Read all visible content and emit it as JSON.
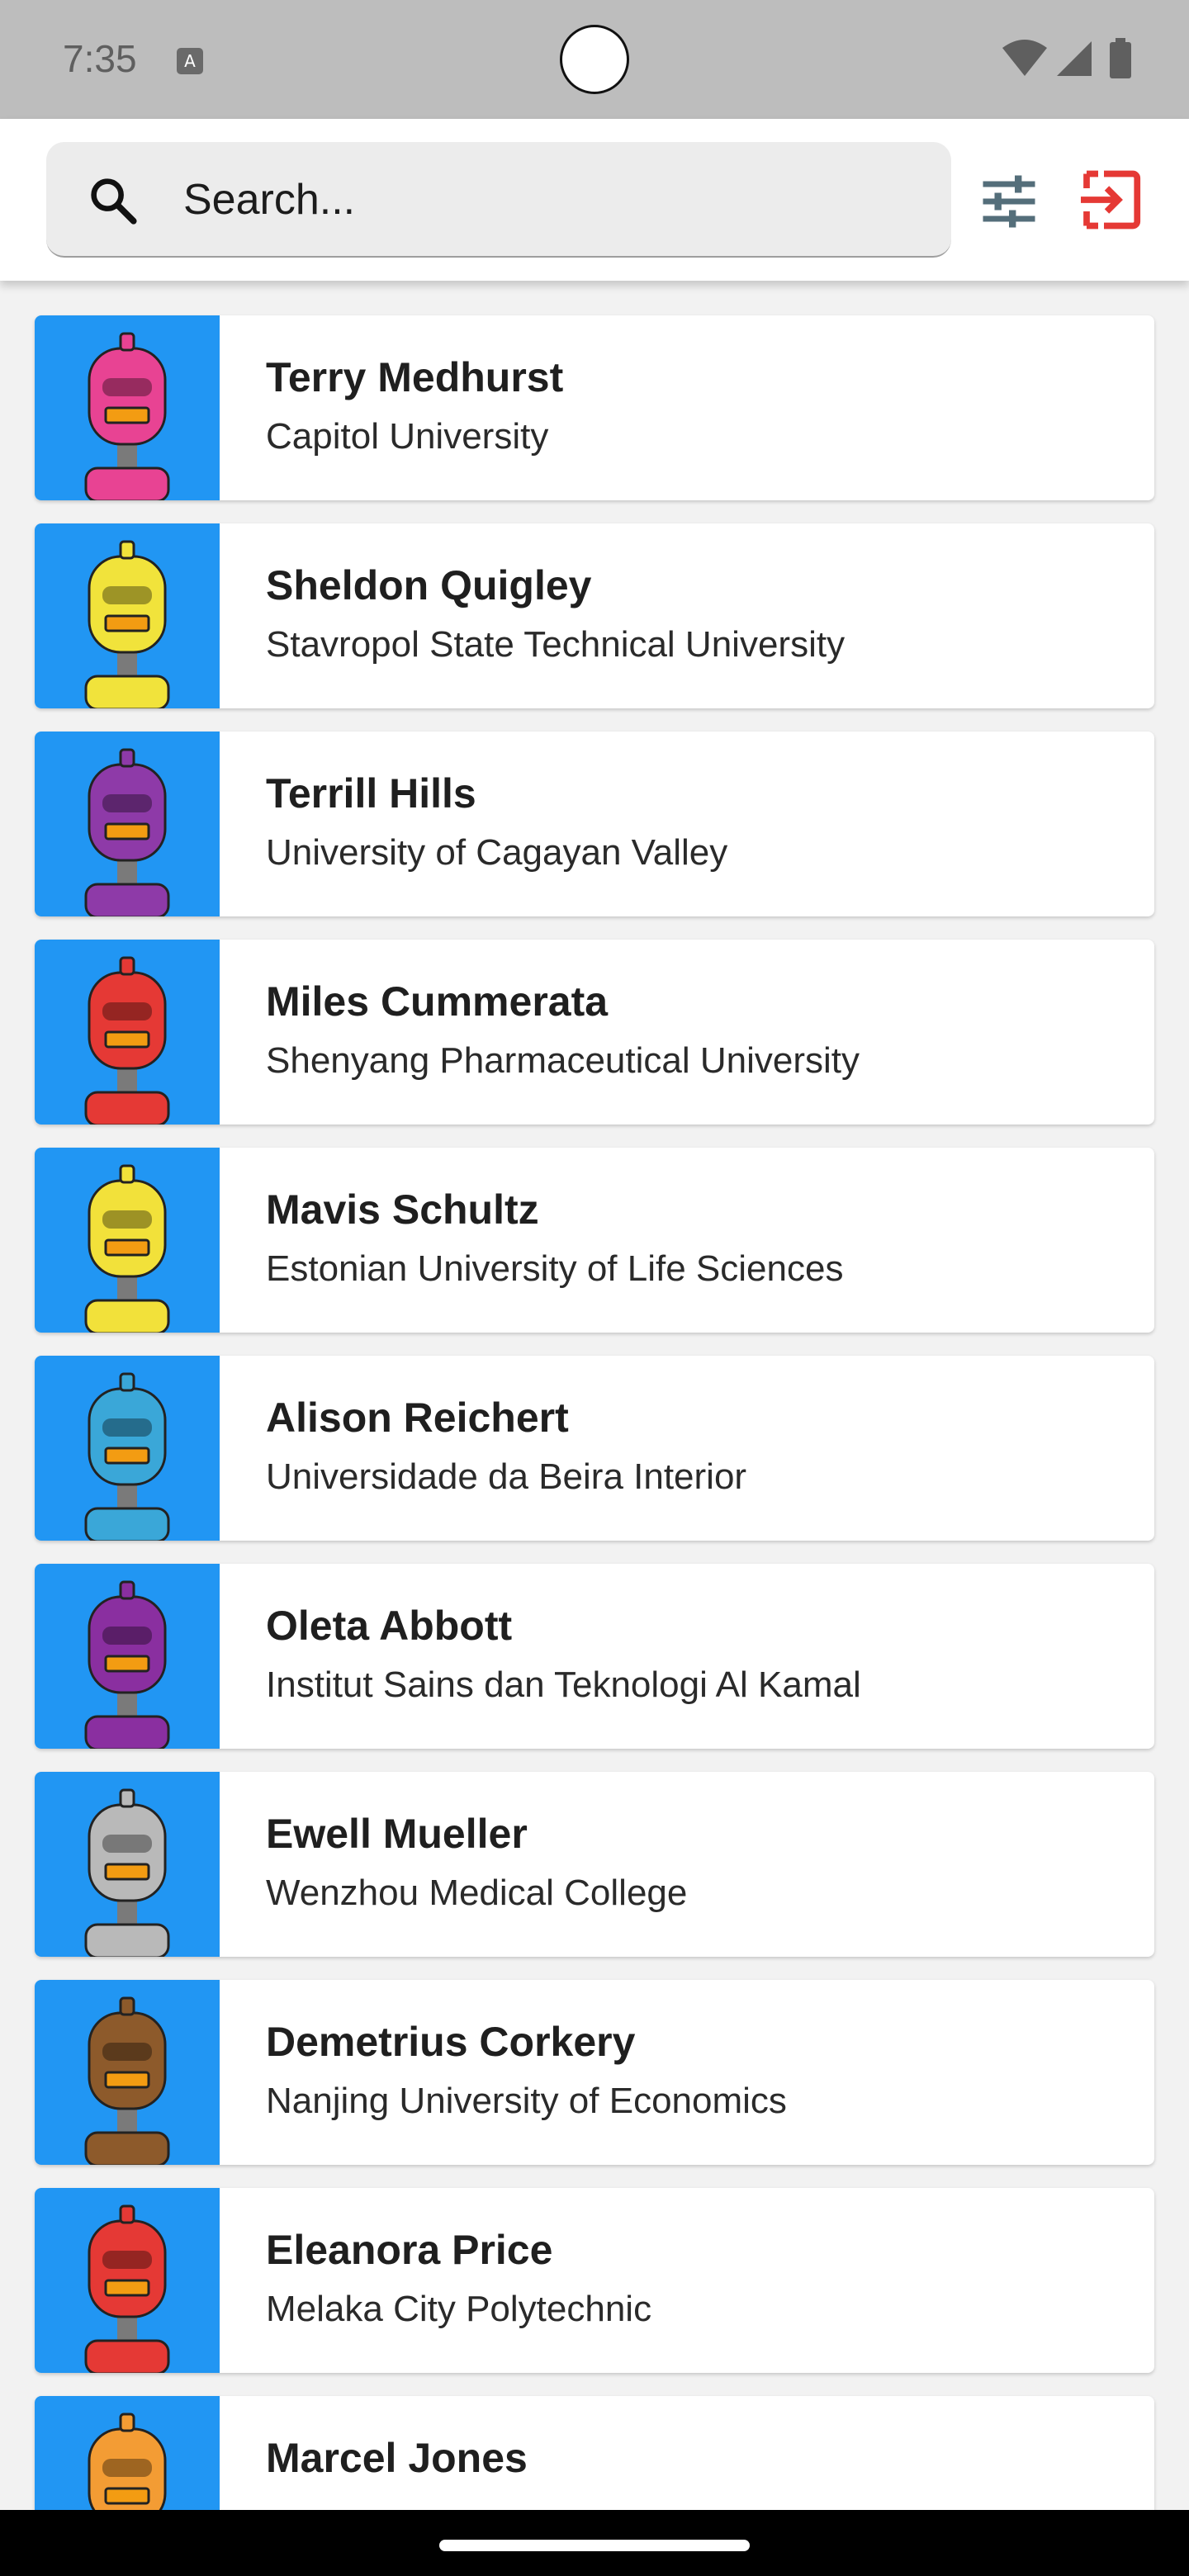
{
  "status_bar": {
    "time": "7:35",
    "icons": [
      "a-notification-icon",
      "wifi-icon",
      "cell-signal-icon",
      "battery-icon"
    ]
  },
  "search": {
    "placeholder": "Search...",
    "value": ""
  },
  "toolbar": {
    "filter_icon": "tune-sliders-icon",
    "logout_icon": "exit-to-app-icon",
    "logout_color": "#e53935",
    "filter_color": "#546e7a"
  },
  "colors": {
    "avatar_background": "#2196f3",
    "card_background": "#ffffff",
    "page_background": "#f2f2f2"
  },
  "people": [
    {
      "name": "Terry Medhurst",
      "school": "Capitol University",
      "robot_color": "#e84393"
    },
    {
      "name": "Sheldon Quigley",
      "school": "Stavropol State Technical University",
      "robot_color": "#f1e33b"
    },
    {
      "name": "Terrill Hills",
      "school": "University of Cagayan Valley",
      "robot_color": "#8e3aa8"
    },
    {
      "name": "Miles Cummerata",
      "school": "Shenyang Pharmaceutical University",
      "robot_color": "#e53935"
    },
    {
      "name": "Mavis Schultz",
      "school": "Estonian University of Life Sciences",
      "robot_color": "#f2e13a"
    },
    {
      "name": "Alison Reichert",
      "school": "Universidade da Beira Interior",
      "robot_color": "#3aa7d8"
    },
    {
      "name": "Oleta Abbott",
      "school": "Institut Sains dan Teknologi Al Kamal",
      "robot_color": "#8a2fa0"
    },
    {
      "name": "Ewell Mueller",
      "school": "Wenzhou Medical College",
      "robot_color": "#b9b9b9"
    },
    {
      "name": "Demetrius Corkery",
      "school": "Nanjing University of Economics",
      "robot_color": "#8d5a2b"
    },
    {
      "name": "Eleanora Price",
      "school": "Melaka City Polytechnic",
      "robot_color": "#e53935"
    },
    {
      "name": "Marcel Jones",
      "school": "",
      "robot_color": "#f39c34"
    }
  ]
}
